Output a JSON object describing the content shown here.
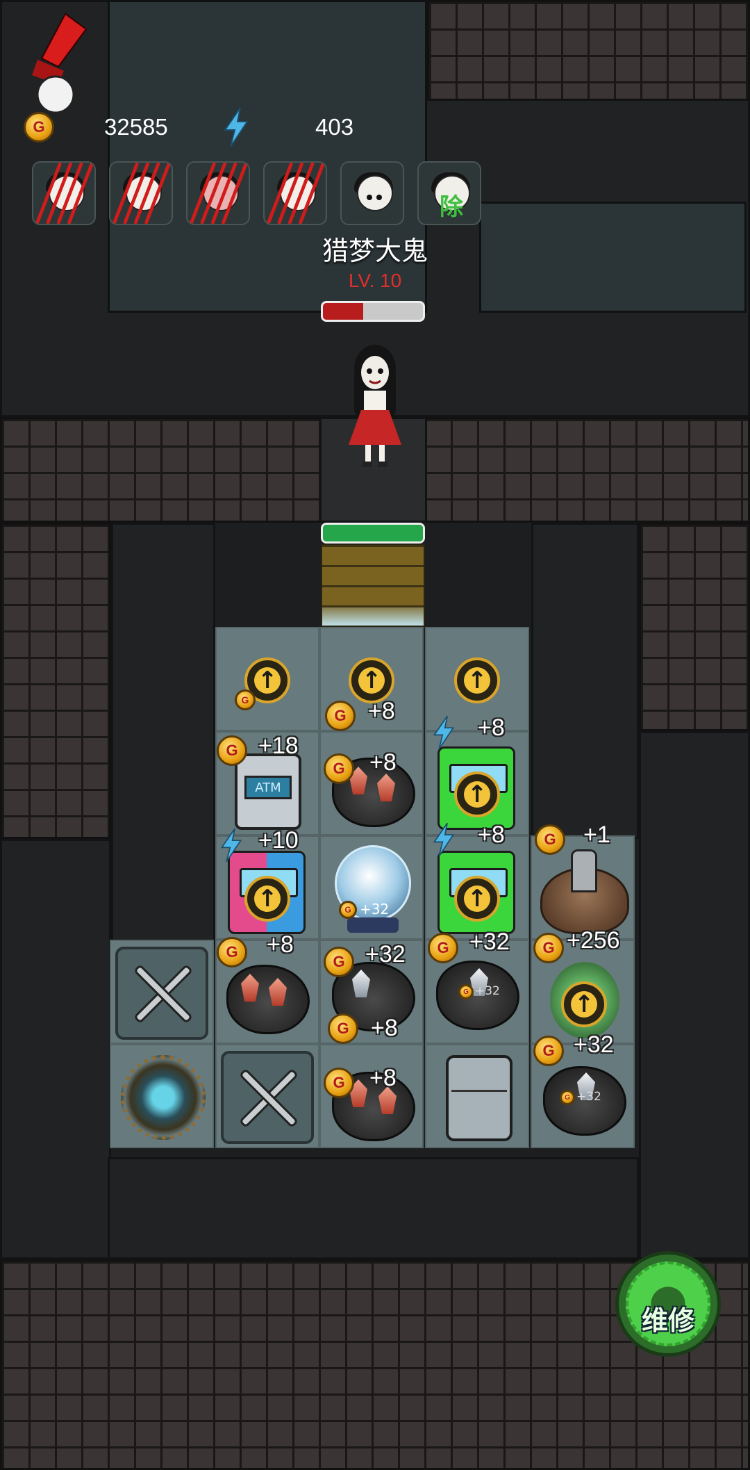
{
  "hud": {
    "gold": "32585",
    "energy": "403",
    "coin_letter": "G"
  },
  "party_slots": [
    {
      "state": "defeated"
    },
    {
      "state": "defeated"
    },
    {
      "state": "defeated"
    },
    {
      "state": "defeated"
    },
    {
      "state": "alive"
    },
    {
      "state": "alive",
      "tag": "除"
    }
  ],
  "boss": {
    "name": "猎梦大鬼",
    "level": "LV. 10",
    "hp_fraction": 0.4
  },
  "door": {
    "hp_fraction": 1.0
  },
  "grid": {
    "r1": {
      "c3": "+8",
      "c4": "+8"
    },
    "r2": {
      "c2": "+18",
      "c3": "+8",
      "c4": "+8"
    },
    "r3": {
      "c2": "+10",
      "c3": "+32",
      "c4": "+8",
      "c5": "+1"
    },
    "r4": {
      "c2": "+8",
      "c3_top": "+32",
      "c3_bottom": "+8",
      "c4": "+32",
      "c5": "+256",
      "c4_small": "+32"
    },
    "r5": {
      "c3": "+8",
      "c5": "+32",
      "c5_small": "+32"
    },
    "atm_text": "ATM"
  },
  "repair_button": {
    "label": "维修"
  },
  "colors": {
    "boss_level": "#e0302d",
    "boss_hp": "#b71d1d",
    "door_hp": "#26a64a",
    "repair": "#4fd04a"
  }
}
